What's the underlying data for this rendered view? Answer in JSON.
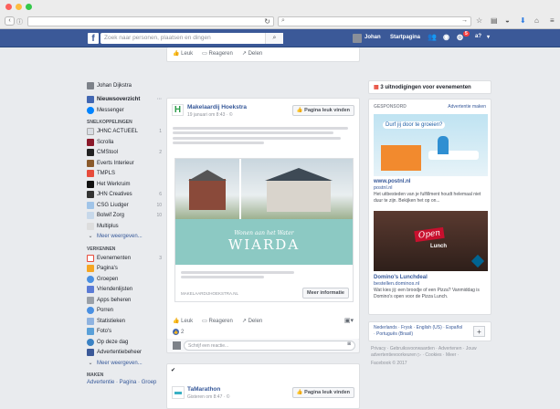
{
  "browser": {
    "reload_icon": "reload-icon",
    "search_placeholder": ""
  },
  "fb": {
    "search_placeholder": "Zoek naar personen, plaatsen en dingen",
    "user_name": "Johan",
    "home_label": "Startpagina",
    "notif_count": "5",
    "quick_help": "?"
  },
  "left": {
    "profile": "Johan Dijkstra",
    "top_items": [
      {
        "label": "Nieuwsoverzicht",
        "more": "···"
      },
      {
        "label": "Messenger"
      }
    ],
    "shortcuts_header": "SNELKOPPELINGEN",
    "shortcuts": [
      {
        "label": "JHNC ACTUEEL",
        "count": "1"
      },
      {
        "label": "Scrolla",
        "count": ""
      },
      {
        "label": "CMStool",
        "count": "2"
      },
      {
        "label": "Everts Interieur",
        "count": ""
      },
      {
        "label": "TMPLS",
        "count": ""
      },
      {
        "label": "Het Werkruim",
        "count": ""
      },
      {
        "label": "JHN Creatives",
        "count": "6"
      },
      {
        "label": "CSG Liudger",
        "count": "10"
      },
      {
        "label": "Bolwif Zorg",
        "count": "10"
      },
      {
        "label": "Multiplus",
        "count": ""
      }
    ],
    "shortcuts_more": "Meer weergeven...",
    "explore_header": "VERKENNEN",
    "explore": [
      {
        "label": "Evenementen",
        "count": "3"
      },
      {
        "label": "Pagina's"
      },
      {
        "label": "Groepen"
      },
      {
        "label": "Vriendenlijsten"
      },
      {
        "label": "Apps beheren"
      },
      {
        "label": "Porren"
      },
      {
        "label": "Statistieken"
      },
      {
        "label": "Foto's"
      },
      {
        "label": "Op deze dag"
      },
      {
        "label": "Advertentiebeheer"
      }
    ],
    "explore_more": "Meer weergeven...",
    "create_header": "MAKEN",
    "create_links": "Advertentie · Pagina · Groep"
  },
  "feed": {
    "top_actions": {
      "like": "Leuk",
      "comment": "Reageren",
      "share": "Delen"
    },
    "post1": {
      "author": "Makelaardij Hoekstra",
      "time": "19 januari om 8:43 · ©",
      "page_like": "Pagina leuk vinden",
      "image_text_small": "Wonen aan het Water",
      "image_text_big": "WIARDA",
      "link_domain": "MAKELAARDIJHOEKSTRA.NL",
      "link_button": "Meer informatie",
      "actions": {
        "like": "Leuk",
        "comment": "Reageren",
        "share": "Delen"
      },
      "reactions_count": "2",
      "comment_placeholder": "Schrijf een reactie..."
    },
    "post2": {
      "author": "TaMarathon",
      "time": "Gisteren om 8:47 · ©",
      "page_like": "Pagina leuk vinden"
    }
  },
  "right": {
    "invites": "3 uitnodigingen voor evenementen",
    "sponsored": "GESPONSORD",
    "create_ad": "Advertentie maken",
    "ad1": {
      "banner_text": "Durf jij door te groeien?",
      "title": "www.postnl.nl",
      "domain": "postnl.nl",
      "desc": "Het uitbesteden van je fulfillment houdt helemaal niet duur te zijn. Bekijken het op on..."
    },
    "ad2": {
      "sign_text": "Open",
      "badge_text": "Lunch",
      "title": "Domino's Lunchdeal",
      "domain": "bestellen.dominos.nl",
      "desc": "Wat kies jij: een broodje of een Pizza? Vanmiddag is Domino's open voor de Pizza Lunch."
    },
    "languages": "Nederlands · Frysk · English (US) · Español · Português (Brasil)",
    "lang_plus": "+",
    "footer": "Privacy · Gebruiksvoorwaarden · Advertenen · Jouw advertentievoorkeuren ▷ · Cookies · Meer ·",
    "copyright": "Facebook © 2017"
  }
}
